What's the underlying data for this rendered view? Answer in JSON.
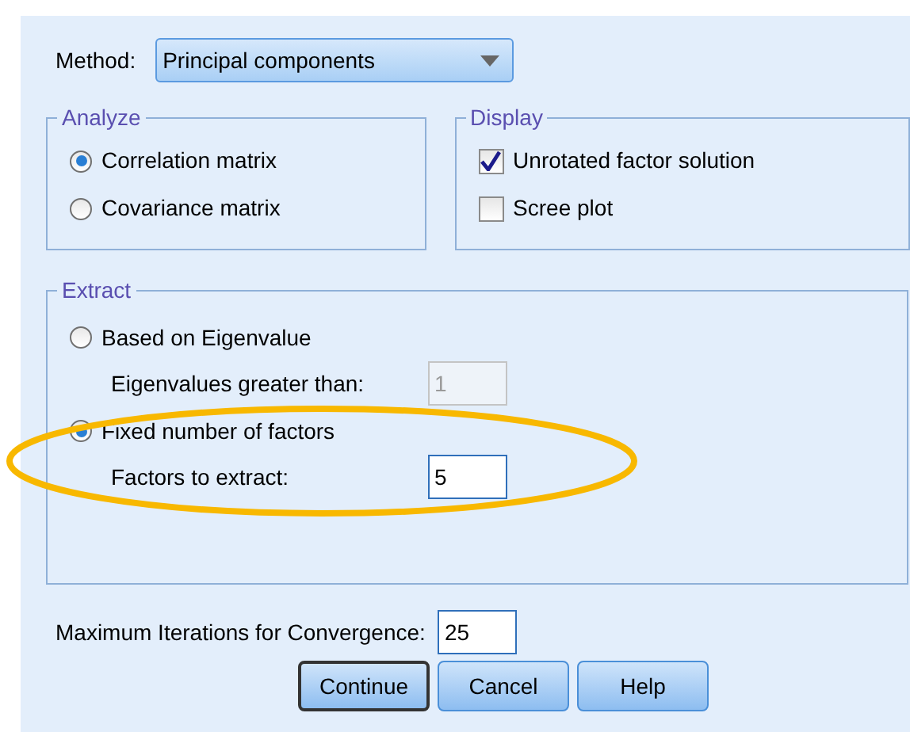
{
  "method": {
    "label": "Method:",
    "value": "Principal components"
  },
  "analyze": {
    "title": "Analyze",
    "options": [
      {
        "label": "Correlation matrix",
        "selected": true
      },
      {
        "label": "Covariance matrix",
        "selected": false
      }
    ]
  },
  "display": {
    "title": "Display",
    "options": [
      {
        "label": "Unrotated factor solution",
        "checked": true
      },
      {
        "label": "Scree plot",
        "checked": false
      }
    ]
  },
  "extract": {
    "title": "Extract",
    "options": [
      {
        "label": "Based on Eigenvalue",
        "selected": false,
        "field": {
          "label": "Eigenvalues greater than:",
          "value": "1",
          "disabled": true
        }
      },
      {
        "label": "Fixed number of factors",
        "selected": true,
        "field": {
          "label": "Factors to extract:",
          "value": "5",
          "disabled": false
        }
      }
    ]
  },
  "iterations": {
    "label": "Maximum Iterations for Convergence:",
    "value": "25"
  },
  "buttons": [
    {
      "label": "Continue",
      "focused": true
    },
    {
      "label": "Cancel",
      "focused": false
    },
    {
      "label": "Help",
      "focused": false
    }
  ]
}
